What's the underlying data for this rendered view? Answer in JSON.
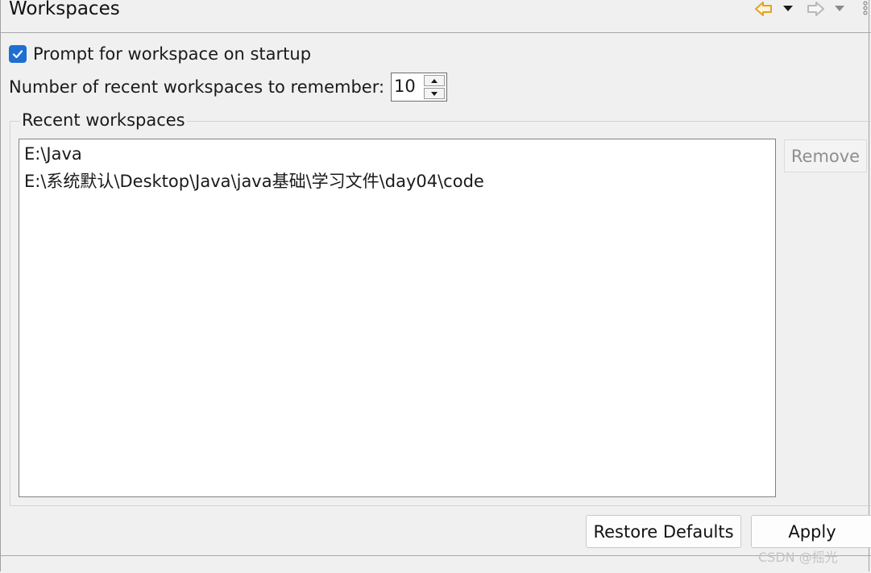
{
  "header": {
    "title": "Workspaces",
    "icons": [
      "back-arrow-icon",
      "dropdown-icon",
      "forward-arrow-icon",
      "dropdown-icon",
      "view-menu-icon"
    ]
  },
  "prompt_option": {
    "label": "Prompt for workspace on startup",
    "checked": true
  },
  "recent_count": {
    "label": "Number of recent workspaces to remember:",
    "value": "10"
  },
  "recent_group": {
    "label": "Recent workspaces",
    "items": [
      "E:\\Java",
      "E:\\系统默认\\Desktop\\Java\\java基础\\学习文件\\day04\\code"
    ],
    "remove_label": "Remove"
  },
  "footer": {
    "restore_label": "Restore Defaults",
    "apply_label": "Apply",
    "watermark": "CSDN @摇光"
  },
  "colors": {
    "checkbox": "#1e6fd1",
    "back_arrow": "#e0a226",
    "forward_arrow": "#b8b8b8"
  }
}
